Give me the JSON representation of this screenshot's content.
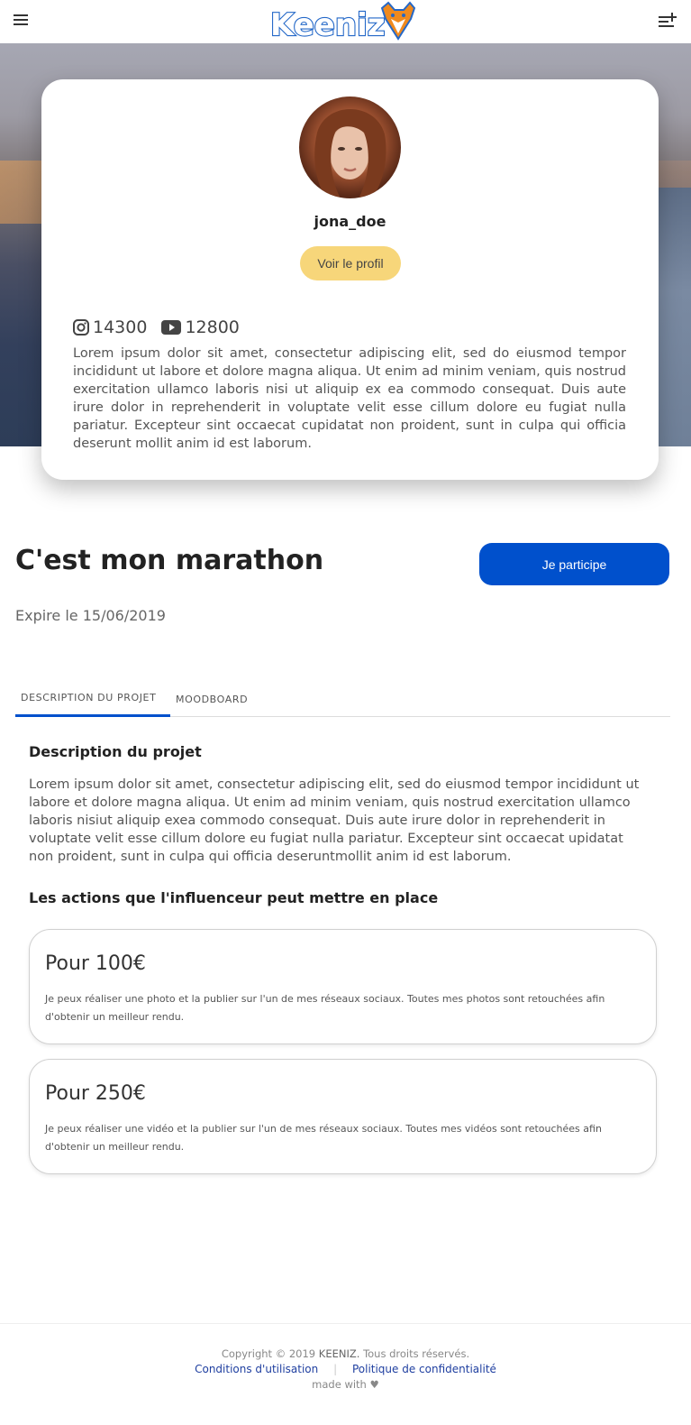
{
  "header": {
    "logo_text": "Keeniz",
    "menu_icon": "hamburger-menu-icon",
    "right_icon": "playlist-add-icon"
  },
  "profile": {
    "username": "jona_doe",
    "view_profile_label": "Voir le profil",
    "instagram_count": "14300",
    "youtube_count": "12800",
    "bio": "Lorem ipsum dolor sit amet, consectetur adipiscing elit, sed do eiusmod tempor incididunt ut labore et dolore magna aliqua. Ut enim ad minim veniam, quis nostrud exercitation ullamco laboris nisi ut aliquip ex ea commodo consequat. Duis aute irure dolor in reprehenderit in voluptate velit esse cillum dolore eu fugiat nulla pariatur. Excepteur sint occaecat cupidatat non proident, sunt in culpa qui officia deserunt mollit anim id est laborum."
  },
  "project": {
    "title": "C'est mon marathon",
    "participate_label": "Je participe",
    "expire_text": "Expire le 15/06/2019"
  },
  "tabs": [
    {
      "label": "DESCRIPTION DU PROJET",
      "active": true
    },
    {
      "label": "MOODBOARD",
      "active": false
    }
  ],
  "description": {
    "heading": "Description du projet",
    "text": "Lorem ipsum dolor sit amet, consectetur adipiscing elit, sed do eiusmod tempor incididunt ut labore et dolore magna aliqua. Ut enim ad minim veniam, quis nostrud exercitation ullamco laboris nisiut aliquip exea commodo consequat. Duis aute irure dolor in reprehenderit in voluptate velit esse cillum dolore eu fugiat nulla pariatur. Excepteur sint occaecat upidatat non proident, sunt in culpa qui officia deseruntmollit anim id est laborum."
  },
  "actions": {
    "heading": "Les actions que l'influenceur peut mettre en place",
    "offers": [
      {
        "price": "Pour 100€",
        "text": "Je peux réaliser une photo et la publier sur l'un de mes réseaux sociaux. Toutes mes photos sont retouchées afin d'obtenir un meilleur rendu."
      },
      {
        "price": "Pour 250€",
        "text": "Je peux réaliser une vidéo et la publier sur l'un de mes réseaux sociaux. Toutes mes vidéos sont retouchées afin d'obtenir un meilleur rendu."
      }
    ]
  },
  "footer": {
    "copyright_prefix": "Copyright © 2019",
    "brand": "KEENIZ.",
    "rights": "Tous droits réservés.",
    "terms_label": "Conditions d'utilisation",
    "separator": "|",
    "privacy_label": "Politique de confidentialité",
    "made_with": "made with ♥"
  },
  "colors": {
    "primary_blue": "#0050cc",
    "profile_button_yellow": "#f7d67a",
    "logo_blue": "#2468c8",
    "logo_orange": "#f08a1e"
  }
}
